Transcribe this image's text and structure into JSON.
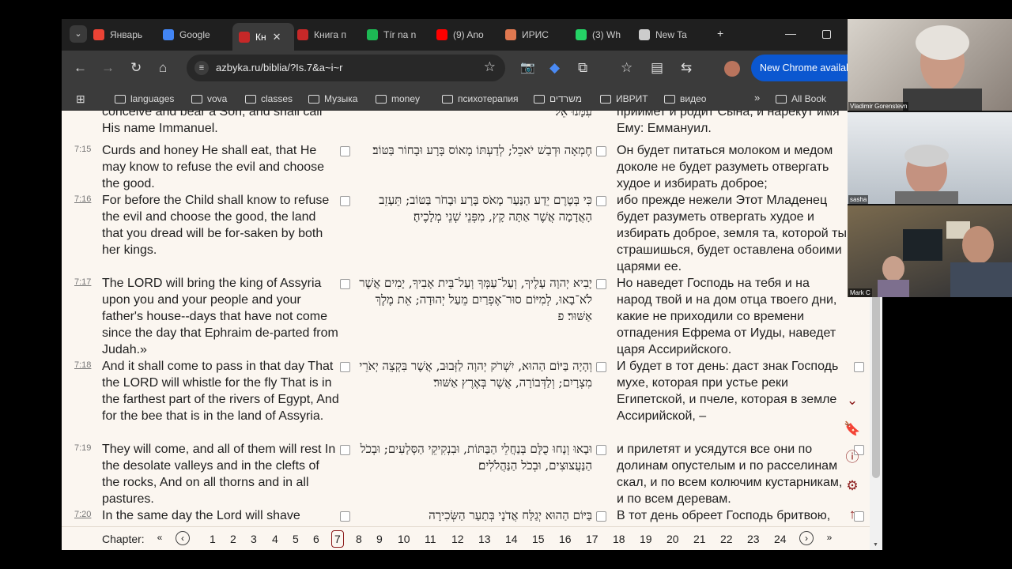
{
  "tabs": [
    {
      "label": "Январь",
      "icon": "gmail-icon",
      "color": "#ea4335"
    },
    {
      "label": "Google",
      "icon": "google-docs-icon",
      "color": "#4285f4"
    },
    {
      "label": "Кн",
      "icon": "book-icon",
      "color": "#c62828",
      "active": true
    },
    {
      "label": "Книга п",
      "icon": "book-icon",
      "color": "#c62828"
    },
    {
      "label": "Tír na n",
      "icon": "spotify-icon",
      "color": "#1db954"
    },
    {
      "label": "(9) Ano",
      "icon": "youtube-icon",
      "color": "#ff0000"
    },
    {
      "label": "ИРИС",
      "icon": "iris-icon",
      "color": "#e07850"
    },
    {
      "label": "(3) Wh",
      "icon": "whatsapp-icon",
      "color": "#25d366"
    },
    {
      "label": "New Ta",
      "icon": "chrome-icon",
      "color": "#cccccc"
    }
  ],
  "toolbar": {
    "url": "azbyka.ru/biblia/?Is.7&a~i~r",
    "update_label": "New Chrome availab"
  },
  "bookmarks": [
    "languages",
    "vova",
    "classes",
    "Музыка",
    "money",
    "психотерапия",
    "משרדים",
    "ИВРИТ",
    "видео"
  ],
  "bookmarks_all": "All Book",
  "verses": [
    {
      "num": "",
      "en": "conceive and bear a Son, and shall call His name Immanuel.",
      "he": "עִמָּנוּ אֵל׃",
      "ru": "приимет и родит Сына, и нарекут имя Ему: Еммануил."
    },
    {
      "num": "7:15",
      "link": false,
      "en": "Curds and honey He shall eat, that He may know to refuse the evil and choose the good.",
      "he": "חֶמְאָה וּדְבַשׁ יֹאכֵל; לְדַעְתּוֹ מָאוֹס בָּרָע וּבָחוֹר בַּטּוֹב׃",
      "ru": "Он будет питаться молоком и медом доколе не будет разуметь отвергать худое и избирать доброе;"
    },
    {
      "num": "7:16",
      "link": true,
      "en": "For before the Child shall know to refuse the evil and choose the good, the land that you dread will be for-saken by both her kings.",
      "he": "כִּי בְּטֶרֶם יֵדַע הַנַּעַר מָאֹס בָּרָע וּבָחֹר בַּטּוֹב; תֵּעָזֵב הָאֲדָמָה אֲשֶׁר אַתָּה קָץ, מִפְּנֵי שְׁנֵי מְלָכֶיהָ׃",
      "ru": "ибо прежде нежели Этот Младенец будет разуметь отвергать худое и избирать доброе, земля та, которой ты страшишься, будет оставлена обоими царями ее."
    },
    {
      "num": "7:17",
      "link": true,
      "en": "The LORD will bring the king of Assyria upon you and your people and your father's house--days that have not come since the day that Ephraim de-parted from Judah.»",
      "he": "יָבִיא יְהוָה עָלֶיךָ, וְעַל־עַמְּךָ וְעַל־בֵּית אָבִיךָ, יָמִים אֲשֶׁר לֹא־בָאוּ, לְמִיּוֹם סוּר־אֶפְרַיִם מֵעַל יְהוּדָה; אֵת מֶלֶךְ אַשּׁוּר׃ פ",
      "ru": "Но наведет Господь на тебя и на народ твой и на дом отца твоего дни, какие не приходили со времени отпадения Ефрема от Иуды, наведет царя Ассирийского."
    },
    {
      "num": "7:18",
      "link": true,
      "en": "And it shall come to pass in that day That the LORD will whistle for the fly That is in the farthest part of the rivers of Egypt, And for the bee that is in the land of Assyria.",
      "he": "וְהָיָה בַּיּוֹם הַהוּא, יִשְׁרֹק יְהוָה לַזְּבוּב, אֲשֶׁר בִּקְצֵה יְאֹרֵי מִצְרָיִם; וְלַדְּבוֹרָה, אֲשֶׁר בְּאֶרֶץ אַשּׁוּר׃",
      "ru": "И будет в тот день: даст знак Господь мухе, которая при устье реки Египетской, и пчеле, которая в земле Ассирийской, –"
    },
    {
      "num": "7:19",
      "link": false,
      "en": "They will come, and all of them will rest In the desolate valleys and in the clefts of the rocks, And on all thorns and in all pastures.",
      "he": "וּבָאוּ וְנָחוּ כֻלָּם בְּנַחֲלֵי הַבַּתּוֹת, וּבִנְקִיקֵי הַסְּלָעִים; וּבְכֹל הַנַּעֲצוּצִים, וּבְכֹל הַנַּהֲלֹלִים׃",
      "ru": "и прилетят и усядутся все они по долинам опустелым и по расселинам скал, и по всем колючим кустарникам, и по всем деревам."
    },
    {
      "num": "7:20",
      "link": true,
      "en": "In the same day the Lord will shave",
      "he": "בַּיּוֹם הַהוּא יְגַלַּח אֲדֹנָי בְּתַעַר הַשְּׂכִירָה",
      "ru": "В тот день обреет Господь бритвою,"
    }
  ],
  "chapter_nav": {
    "label": "Chapter:",
    "chapters": [
      "1",
      "2",
      "3",
      "4",
      "5",
      "6",
      "7",
      "8",
      "9",
      "10",
      "11",
      "12",
      "13",
      "14",
      "15",
      "16",
      "17",
      "18",
      "19",
      "20",
      "21",
      "22",
      "23",
      "24"
    ],
    "current": "7"
  },
  "participants": [
    {
      "name": "Vladimir Gorenstevn"
    },
    {
      "name": "sasha"
    },
    {
      "name": "Mark C"
    }
  ]
}
